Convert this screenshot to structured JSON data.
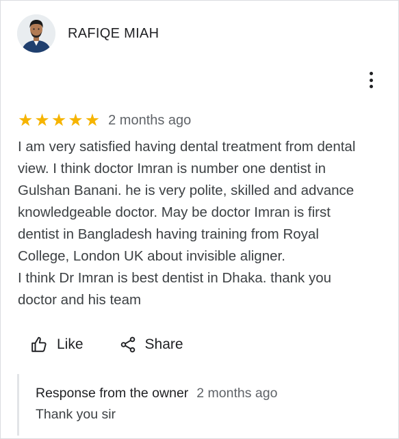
{
  "reviewer": {
    "name": "RAFIQE MIAH"
  },
  "review": {
    "rating": 5,
    "stars": [
      "★",
      "★",
      "★",
      "★",
      "★"
    ],
    "time": "2 months ago",
    "text": "I am very satisfied having dental treatment from dental\nview. I think doctor Imran is number one dentist in\nGulshan Banani. he is very polite, skilled and advance\nknowledgeable doctor. May be doctor Imran is first\ndentist in Bangladesh having training from Royal\nCollege, London UK about invisible aligner.\nI think Dr Imran is best dentist in Dhaka. thank you\ndoctor and his team"
  },
  "actions": {
    "like_label": "Like",
    "share_label": "Share"
  },
  "owner_response": {
    "label": "Response from the owner",
    "time": "2 months ago",
    "text": "Thank you sir"
  },
  "colors": {
    "star": "#f6b400",
    "muted_text": "#5f6368",
    "body_text": "#3c4043",
    "border": "#dadce0"
  },
  "icons": {
    "more": "more-vert-icon",
    "like": "thumb-up-icon",
    "share": "share-icon"
  }
}
